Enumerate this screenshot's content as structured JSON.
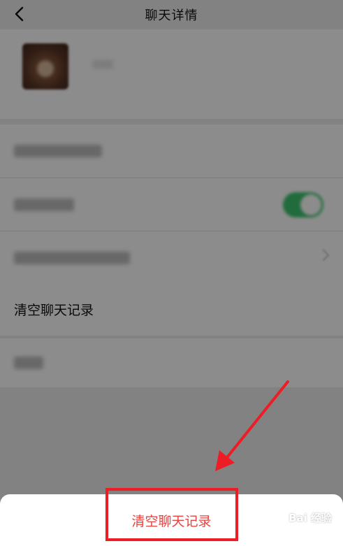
{
  "nav": {
    "title": "聊天详情",
    "back_icon": "chevron-left-icon"
  },
  "settings": {
    "clear_history_label": "清空聊天记录"
  },
  "action_sheet": {
    "clear_history_button": "清空聊天记录",
    "button_color": "#e64340"
  },
  "annotation": {
    "highlight_color": "#ee1c25"
  },
  "watermark": {
    "text": "Bai 经验"
  },
  "colors": {
    "toggle_on": "#3ec46d",
    "background": "#ededed"
  }
}
